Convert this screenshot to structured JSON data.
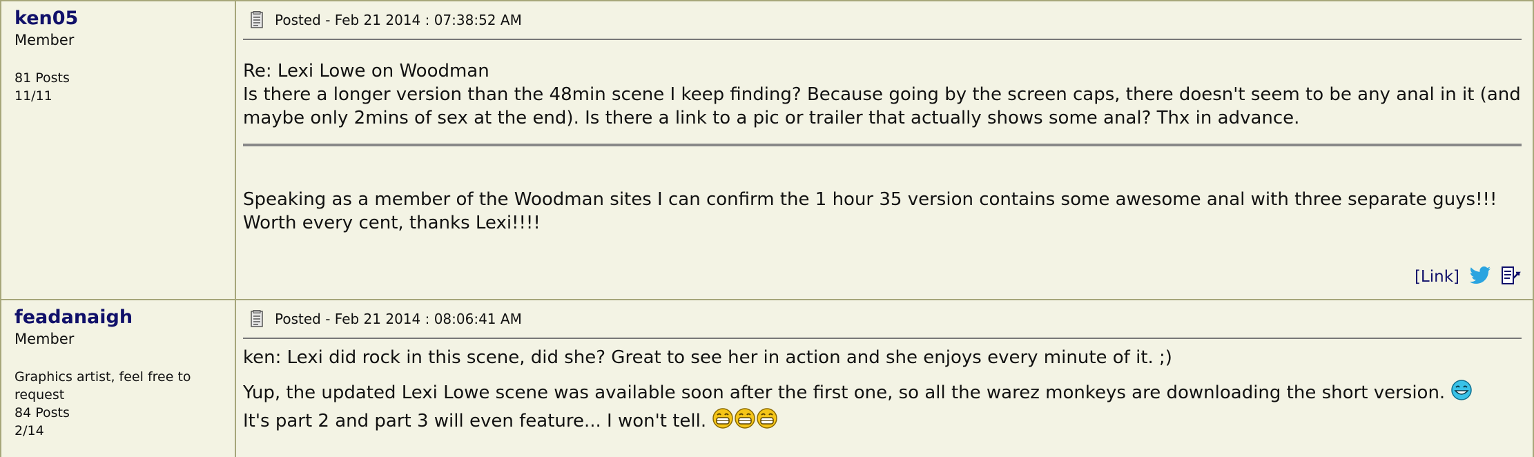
{
  "posts": [
    {
      "author": {
        "name": "ken05",
        "role": "Member",
        "signature": "",
        "posts": "81 Posts",
        "ratio": "11/11"
      },
      "posted": "Posted - Feb 21 2014 :  07:38:52 AM",
      "quote": {
        "title": "Re: Lexi Lowe on Woodman",
        "body": "Is there a longer version than the 48min scene I keep finding? Because going by the screen caps, there doesn't seem to be any anal in it (and maybe only 2mins of sex at the end). Is there a link to a pic or trailer that actually shows some anal? Thx in advance."
      },
      "body": "Speaking as a member of the Woodman sites I can confirm the 1 hour 35 version contains some awesome anal with three separate guys!!! Worth every cent, thanks Lexi!!!!",
      "link_label": "[Link]"
    },
    {
      "author": {
        "name": "feadanaigh",
        "role": "Member",
        "signature": "Graphics artist, feel free to request",
        "posts": "84 Posts",
        "ratio": "2/14"
      },
      "posted": "Posted - Feb 21 2014 :  08:06:41 AM",
      "para1": "ken: Lexi did rock in this scene, did she? Great to see her in action and she enjoys every minute of it. ;)",
      "para2": "Yup, the updated Lexi Lowe scene was available soon after the first one, so all the warez monkeys are downloading the short version.",
      "para3": "It's part 2 and part 3 will even feature... I won't tell."
    }
  ],
  "colors": {
    "background": "#f3f3e4",
    "border": "#a6a67a",
    "username": "#10106a",
    "twitter": "#2aa4e0"
  },
  "icons": [
    "doc-icon",
    "twitter-icon",
    "quote-reply-icon",
    "laughing-smiley-icon",
    "grin-smiley-icon"
  ]
}
